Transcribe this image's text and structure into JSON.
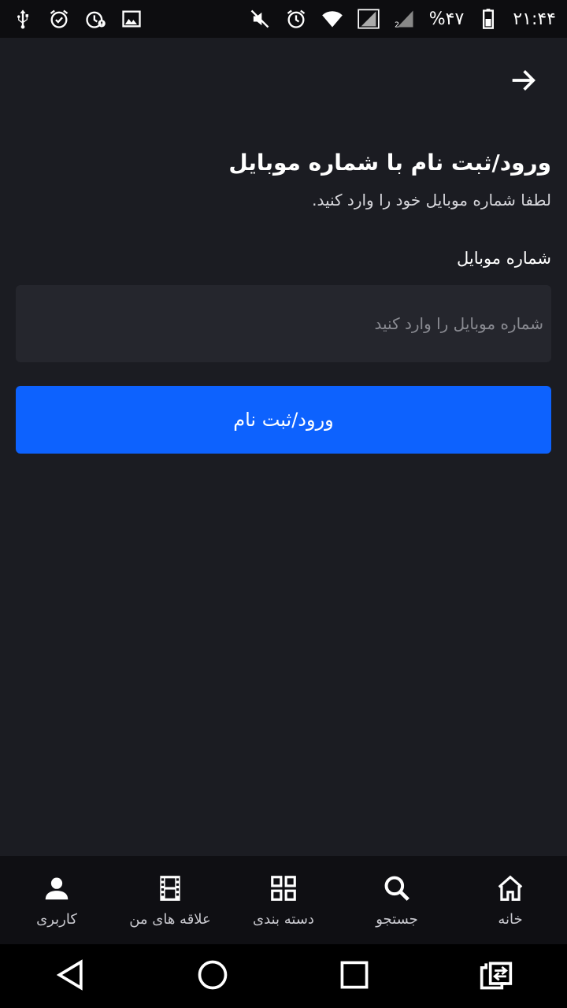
{
  "status_bar": {
    "time": "۲۱:۴۴",
    "battery_text": "%۴۷",
    "left_icons": [
      "usb-icon",
      "alarm-check-icon",
      "alarm-alert-icon",
      "image-icon"
    ],
    "right_icons": [
      "mute-icon",
      "alarm-icon",
      "wifi-icon",
      "signal-sim1-icon",
      "signal-sim2-icon",
      "battery-icon"
    ]
  },
  "header": {
    "back_icon": "arrow-right-icon"
  },
  "login": {
    "title": "ورود/ثبت نام با شماره موبایل",
    "subtitle": "لطفا شماره موبایل خود را وارد کنید.",
    "field_label": "شماره موبایل",
    "input_placeholder": "شماره موبایل را وارد کنید",
    "input_value": "",
    "submit_label": "ورود/ثبت نام",
    "accent_color": "#0d62fe"
  },
  "bottom_nav": {
    "items": [
      {
        "label": "کاربری",
        "icon": "person-icon"
      },
      {
        "label": "علاقه های من",
        "icon": "film-icon"
      },
      {
        "label": "دسته بندی",
        "icon": "grid-icon"
      },
      {
        "label": "جستجو",
        "icon": "search-icon"
      },
      {
        "label": "خانه",
        "icon": "home-icon"
      }
    ]
  },
  "system_nav": {
    "buttons": [
      "back-triangle-icon",
      "home-circle-icon",
      "recents-square-icon",
      "switch-app-icon"
    ]
  }
}
